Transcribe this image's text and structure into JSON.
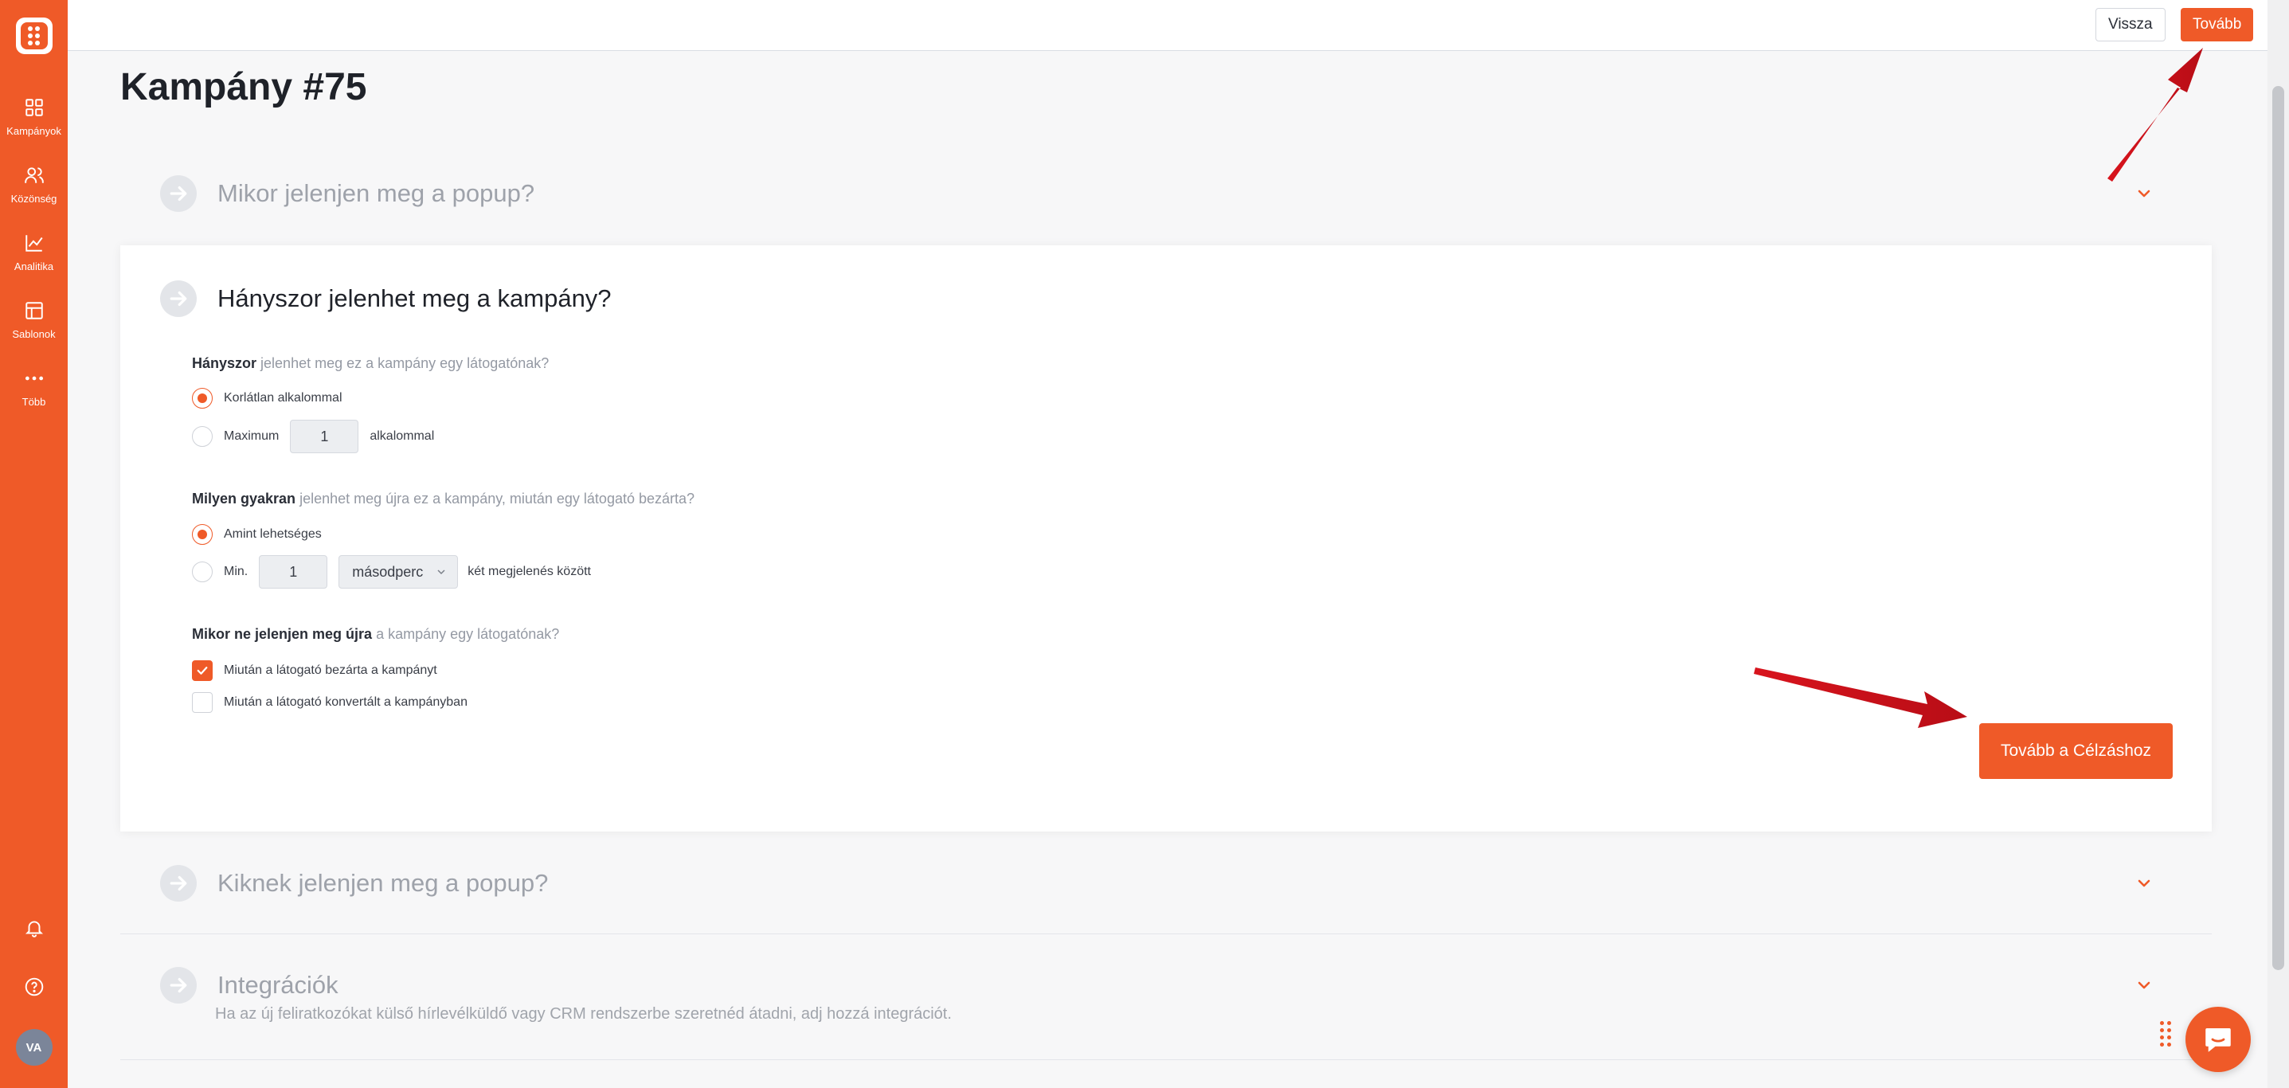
{
  "sidebar": {
    "items": [
      {
        "label": "Kampányok",
        "icon": "grid-icon"
      },
      {
        "label": "Közönség",
        "icon": "users-icon"
      },
      {
        "label": "Analitika",
        "icon": "chart-icon"
      },
      {
        "label": "Sablonok",
        "icon": "layout-icon"
      },
      {
        "label": "Több",
        "icon": "more-icon"
      }
    ],
    "avatar_initials": "VA"
  },
  "topbar": {
    "back_label": "Vissza",
    "next_label": "Tovább"
  },
  "page": {
    "title": "Kampány #75"
  },
  "sections": {
    "when": {
      "title": "Mikor jelenjen meg a popup?"
    },
    "frequency": {
      "title": "Hányszor jelenhet meg a kampány?",
      "q1_bold": "Hányszor",
      "q1_rest": " jelenhet meg ez a kampány egy látogatónak?",
      "q1_opt1": "Korlátlan alkalommal",
      "q1_opt2_prefix": "Maximum",
      "q1_opt2_value": "1",
      "q1_opt2_suffix": "alkalommal",
      "q2_bold": "Milyen gyakran",
      "q2_rest": " jelenhet meg újra ez a kampány, miután egy látogató bezárta?",
      "q2_opt1": "Amint lehetséges",
      "q2_opt2_prefix": "Min.",
      "q2_opt2_value": "1",
      "q2_opt2_unit": "másodperc",
      "q2_opt2_suffix": "két megjelenés között",
      "q3_bold": "Mikor ne jelenjen meg újra",
      "q3_rest": " a kampány egy látogatónak?",
      "q3_opt1": "Miután a látogató bezárta a kampányt",
      "q3_opt2": "Miután a látogató konvertált a kampányban",
      "cta_label": "Tovább a Célzáshoz"
    },
    "who": {
      "title": "Kiknek jelenjen meg a popup?"
    },
    "integrations": {
      "title": "Integrációk",
      "description": "Ha az új feliratkozókat külső hírlevélküldő vagy CRM rendszerbe szeretnéd átadni, adj hozzá integrációt."
    }
  },
  "colors": {
    "brand": "#ef5a28",
    "annotation_arrow": "#c8101a"
  }
}
